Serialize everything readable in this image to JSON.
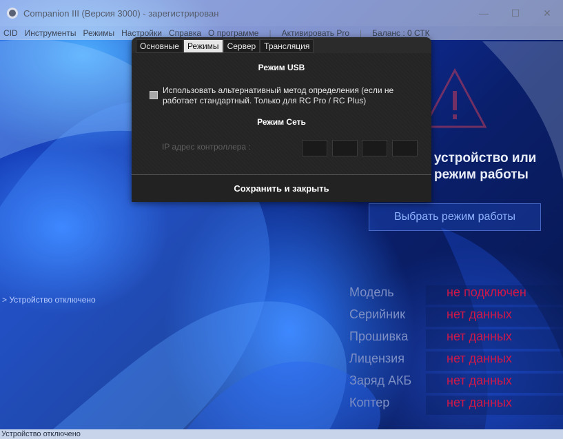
{
  "window": {
    "title": "Companion III (Версия 3000) - зарегистрирован",
    "minimize_glyph": "—",
    "maximize_glyph": "☐",
    "close_glyph": "✕"
  },
  "menu": {
    "items": [
      "CID",
      "Инструменты",
      "Режимы",
      "Настройки",
      "Справка",
      "О программе"
    ],
    "activate": "Активировать Pro",
    "balance": "Баланс : 0 СТК",
    "separator": "|"
  },
  "background": {
    "warning_line1": "е устройство или",
    "warning_line2": "е режим работы",
    "select_mode_button": "Выбрать режим работы",
    "device_state": "> Устройство отключено",
    "info_rows": [
      {
        "label": "Модель",
        "value": "не подключен"
      },
      {
        "label": "Серийник",
        "value": "нет данных"
      },
      {
        "label": "Прошивка",
        "value": "нет данных"
      },
      {
        "label": "Лицензия",
        "value": "нет данных"
      },
      {
        "label": "Заряд АКБ",
        "value": "нет данных"
      },
      {
        "label": "Коптер",
        "value": "нет данных"
      }
    ],
    "status_bar": "Устройство отключено",
    "colors": {
      "value_red": "#d01848",
      "label_gray": "#7d8fc4"
    }
  },
  "dialog": {
    "tabs": [
      {
        "label": "Основные",
        "active": false
      },
      {
        "label": "Режимы",
        "active": true
      },
      {
        "label": "Сервер",
        "active": false
      },
      {
        "label": "Трансляция",
        "active": false
      }
    ],
    "usb_title": "Режим USB",
    "alt_method_checked": false,
    "alt_method_label": "Использовать альтернативный метод определения (если не работает стандартный. Только для RC Pro / RC Plus)",
    "network_title": "Режим Сеть",
    "ip_label": "IP адрес контроллера :",
    "ip_octets": [
      "",
      "",
      "",
      ""
    ],
    "save_button": "Сохранить и закрыть"
  }
}
